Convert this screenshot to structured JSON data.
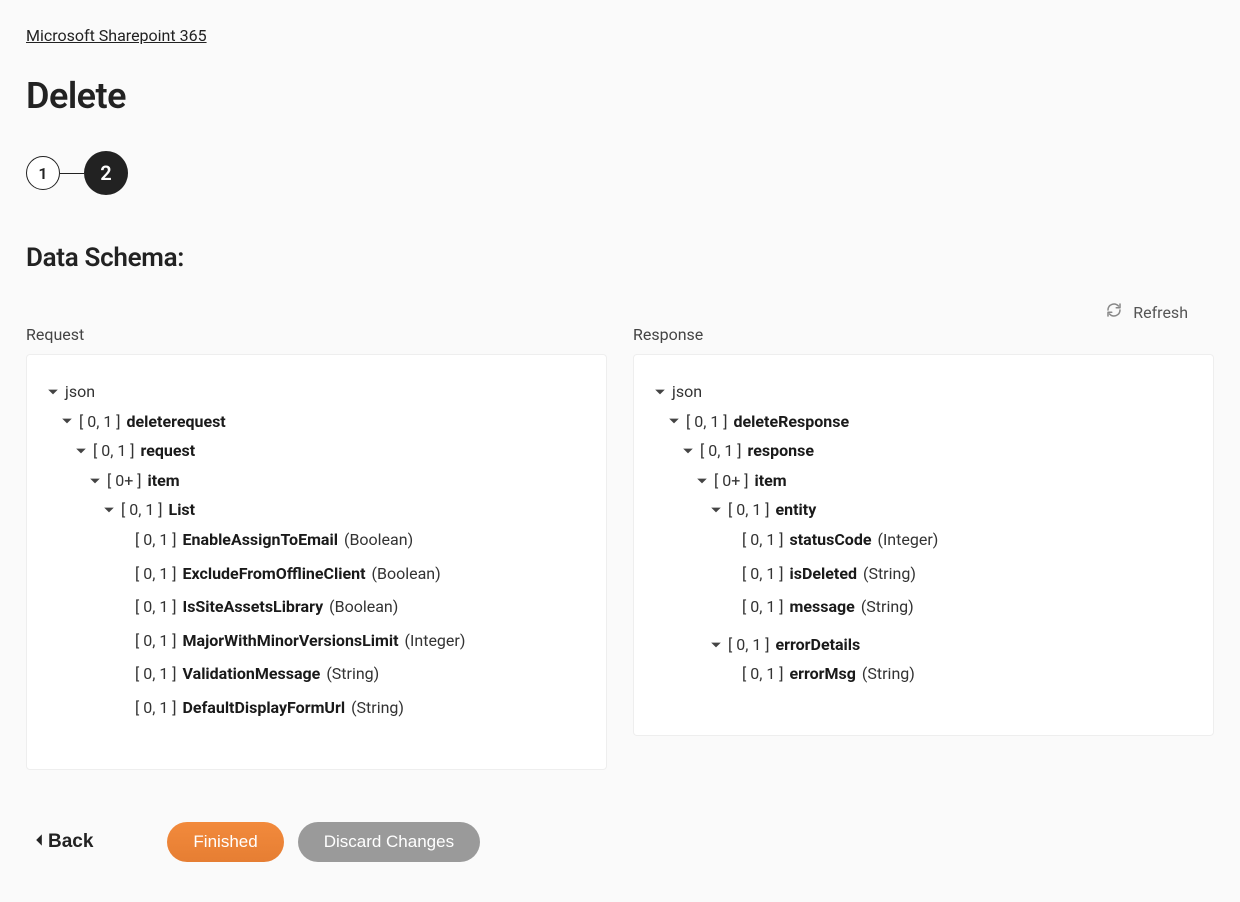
{
  "breadcrumb": "Microsoft Sharepoint 365",
  "page_title": "Delete",
  "stepper": {
    "step1": "1",
    "step2": "2"
  },
  "section_title": "Data Schema:",
  "refresh_label": "Refresh",
  "columns": {
    "request": "Request",
    "response": "Response"
  },
  "request_tree": {
    "root": "json",
    "n1_card": "[ 0, 1 ]",
    "n1_name": "deleterequest",
    "n2_card": "[ 0, 1 ]",
    "n2_name": "request",
    "n3_card": "[ 0+ ]",
    "n3_name": "item",
    "n4_card": "[ 0, 1 ]",
    "n4_name": "List",
    "leaves": [
      {
        "card": "[ 0, 1 ]",
        "name": "EnableAssignToEmail",
        "type": "(Boolean)"
      },
      {
        "card": "[ 0, 1 ]",
        "name": "ExcludeFromOfflineClient",
        "type": "(Boolean)"
      },
      {
        "card": "[ 0, 1 ]",
        "name": "IsSiteAssetsLibrary",
        "type": "(Boolean)"
      },
      {
        "card": "[ 0, 1 ]",
        "name": "MajorWithMinorVersionsLimit",
        "type": "(Integer)"
      },
      {
        "card": "[ 0, 1 ]",
        "name": "ValidationMessage",
        "type": "(String)"
      },
      {
        "card": "[ 0, 1 ]",
        "name": "DefaultDisplayFormUrl",
        "type": "(String)"
      }
    ]
  },
  "response_tree": {
    "root": "json",
    "n1_card": "[ 0, 1 ]",
    "n1_name": "deleteResponse",
    "n2_card": "[ 0, 1 ]",
    "n2_name": "response",
    "n3_card": "[ 0+ ]",
    "n3_name": "item",
    "n4_card": "[ 0, 1 ]",
    "n4_name": "entity",
    "entity_leaves": [
      {
        "card": "[ 0, 1 ]",
        "name": "statusCode",
        "type": "(Integer)"
      },
      {
        "card": "[ 0, 1 ]",
        "name": "isDeleted",
        "type": "(String)"
      },
      {
        "card": "[ 0, 1 ]",
        "name": "message",
        "type": "(String)"
      }
    ],
    "n5_card": "[ 0, 1 ]",
    "n5_name": "errorDetails",
    "error_leaves": [
      {
        "card": "[ 0, 1 ]",
        "name": "errorMsg",
        "type": "(String)"
      }
    ]
  },
  "footer": {
    "back": "Back",
    "finished": "Finished",
    "discard": "Discard Changes"
  }
}
